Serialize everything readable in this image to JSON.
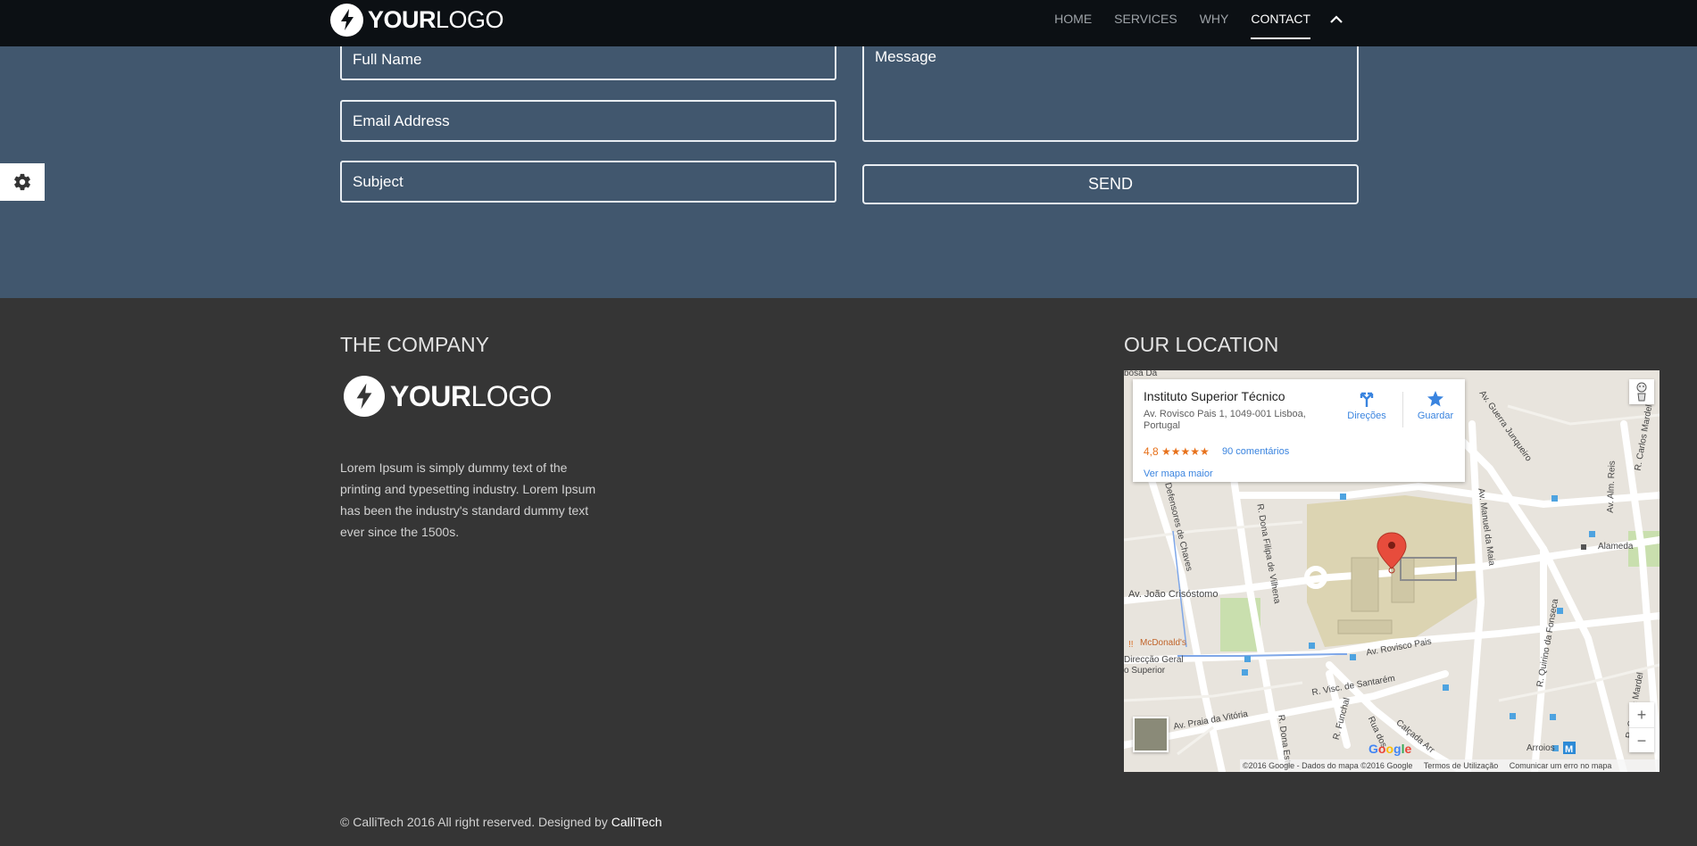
{
  "header": {
    "logo_bold": "YOUR",
    "logo_light": "LOGO",
    "nav": [
      {
        "label": "HOME",
        "active": false
      },
      {
        "label": "SERVICES",
        "active": false
      },
      {
        "label": "WHY",
        "active": false
      },
      {
        "label": "CONTACT",
        "active": true
      }
    ],
    "collapse_icon": "chevron-up-icon"
  },
  "contact_form": {
    "full_name_placeholder": "Full Name",
    "email_placeholder": "Email Address",
    "subject_placeholder": "Subject",
    "message_placeholder": "Message",
    "send_label": "SEND"
  },
  "settings_icon": "gear-icon",
  "footer": {
    "company": {
      "title": "THE COMPANY",
      "logo_bold": "YOUR",
      "logo_light": "LOGO",
      "text": "Lorem Ipsum is simply dummy text of the printing and typesetting industry. Lorem Ipsum has been the industry's standard dummy text ever since the 1500s."
    },
    "location": {
      "title": "OUR LOCATION"
    },
    "copyright_text": "© CalliTech 2016 All right reserved. Designed by ",
    "copyright_link": "CalliTech"
  },
  "map": {
    "place_name": "Instituto Superior Técnico",
    "address": "Av. Rovisco Pais 1, 1049-001 Lisboa, Portugal",
    "rating": "4,8 ★★★★★",
    "reviews": "90 comentários",
    "directions_label": "Direções",
    "save_label": "Guardar",
    "bigger_map_label": "Ver mapa maior",
    "zoom_in": "+",
    "zoom_out": "−",
    "footer_copyright": "©2016 Google - Dados do mapa ©2016 Google",
    "footer_terms": "Termos de Utilização",
    "footer_report": "Comunicar um erro no mapa",
    "google_mark": "Google",
    "labels": {
      "alameda": "Alameda",
      "joao_crisostomo": "Av. João Crisóstomo",
      "mcdonalds": "McDonald's",
      "rovisco_pais": "Av. Rovisco Pais",
      "santarem": "R. Visc. de Santarém",
      "praia_vitoria": "Av. Praia da Vitória",
      "arroios": "Arroios",
      "dona_filipa": "R. Dona Filipa de Vilhena",
      "manuel_maia": "Av. Manuel da Maia",
      "guerra_junqueiro": "Av. Guerra Junqueiro",
      "defensores_chaves": "Defensores de Chaves",
      "alm_reis": "Av. Alm. Reis",
      "quirino_fonseca": "R. Quirino da Fonseca",
      "carlos_mardel": "R. Carlos Mardel",
      "direccao_geral": "Direcção Geral",
      "ensino_superior": "o Superior",
      "funchal": "R. Funchal",
      "rua_dos": "Rua dos",
      "calcada": "Calçada Arr",
      "dona_estefania": "R. Dona Este",
      "sa_da_bandeira": "bosa Da"
    }
  }
}
